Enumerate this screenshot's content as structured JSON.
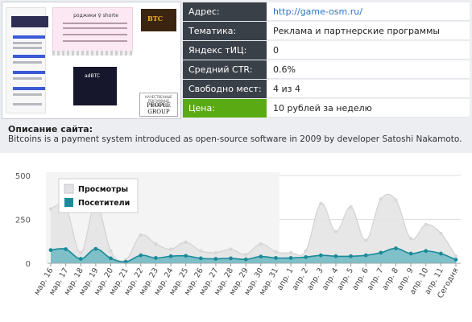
{
  "site": {
    "rows": [
      {
        "label": "Адрес:",
        "value": "http://game-osm.ru/",
        "is_link": true
      },
      {
        "label": "Тематика:",
        "value": "Реклама и партнерские программы"
      },
      {
        "label": "Яндекс тИЦ:",
        "value": "0"
      },
      {
        "label": "Средний CTR:",
        "value": "0.6%"
      },
      {
        "label": "Свободно мест:",
        "value": "4 из 4"
      },
      {
        "label": "Цена:",
        "value": "10 рублей за неделю",
        "highlight": true
      }
    ],
    "preview": {
      "pink_title": "роджики ♀ shorte",
      "dark_ad_text": "adBTC",
      "btc_logo": "BTC",
      "pg_caption": "КАЧЕСТВЕННЫЕ РЕКЛАМНЫЕ РЕШЕНИЯ",
      "pg_name": "PEOPLE GROUP"
    }
  },
  "description": {
    "title": "Описание сайта:",
    "text": "Bitcoins is a payment system introduced as open-source software in 2009 by developer Satoshi Nakamoto."
  },
  "colors": {
    "label_bg": "#3a4048",
    "price_bg": "#5aaa14",
    "link": "#2a74c4",
    "views_fill": "#e4e4e6",
    "visitors_line": "#1b8a9a",
    "visitors_fill": "#2aa0ae"
  },
  "chart_data": {
    "type": "area",
    "categories": [
      "мар. 16",
      "мар. 17",
      "мар. 18",
      "мар. 19",
      "мар. 20",
      "мар. 21",
      "мар. 22",
      "мар. 23",
      "мар. 24",
      "мар. 25",
      "мар. 26",
      "мар. 27",
      "мар. 28",
      "мар. 29",
      "мар. 30",
      "мар. 31",
      "апр. 1",
      "апр. 2",
      "апр. 3",
      "апр. 4",
      "апр. 5",
      "апр. 6",
      "апр. 7",
      "апр. 8",
      "апр. 9",
      "апр. 10",
      "апр. 11",
      "Сегодня"
    ],
    "series": [
      {
        "name": "Просмотры",
        "values": [
          310,
          320,
          60,
          340,
          70,
          20,
          160,
          110,
          80,
          120,
          70,
          60,
          80,
          50,
          110,
          65,
          60,
          70,
          340,
          180,
          320,
          130,
          365,
          360,
          140,
          220,
          170,
          40
        ]
      },
      {
        "name": "Посетители",
        "values": [
          75,
          80,
          25,
          82,
          28,
          8,
          45,
          30,
          40,
          42,
          28,
          25,
          28,
          22,
          38,
          30,
          30,
          35,
          45,
          40,
          40,
          45,
          60,
          85,
          55,
          70,
          55,
          20
        ]
      }
    ],
    "yticks": [
      0,
      250,
      500
    ],
    "ylim": [
      0,
      500
    ],
    "grid": true,
    "legend": "top-left"
  }
}
